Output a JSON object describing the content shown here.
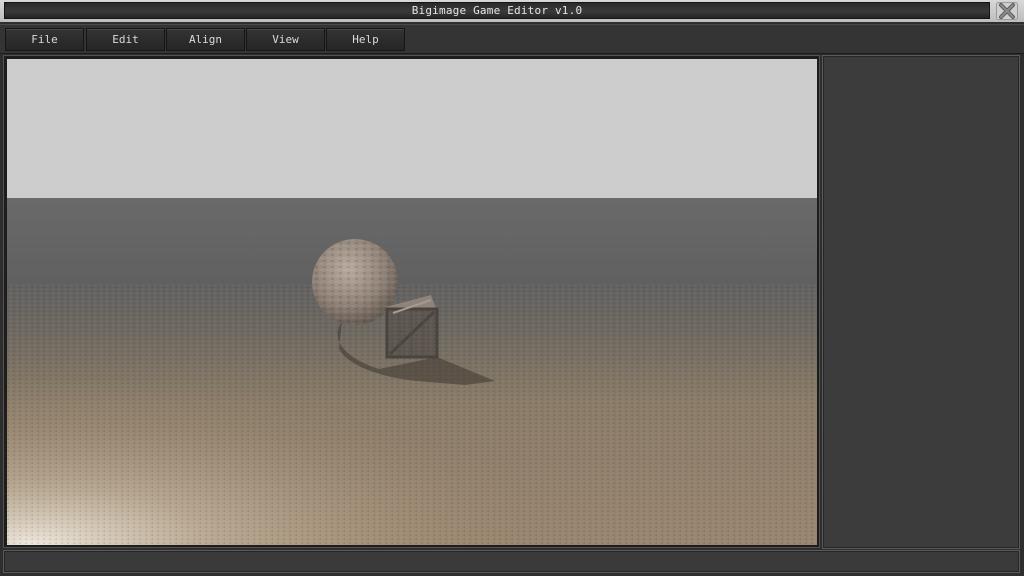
{
  "window": {
    "title": "Bigimage Game Editor v1.0"
  },
  "titlebar": {
    "close_icon": "close-x-icon"
  },
  "menu": {
    "items": [
      {
        "label": "File"
      },
      {
        "label": "Edit"
      },
      {
        "label": "Align"
      },
      {
        "label": "View"
      },
      {
        "label": "Help"
      }
    ]
  },
  "scene": {
    "objects": [
      "sphere",
      "crate",
      "ground-plane"
    ],
    "sky_color": "#cdcdcd",
    "ground_color": "#8a7a64"
  },
  "colors": {
    "frame_dark": "#2e2e2e",
    "panel": "#3c3c3c",
    "title_text": "#e6e6e6"
  }
}
